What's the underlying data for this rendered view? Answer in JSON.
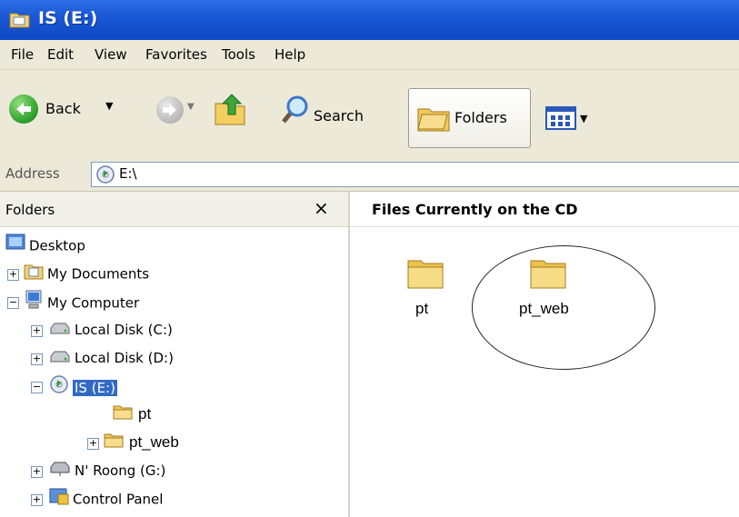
{
  "window": {
    "title": "IS (E:)"
  },
  "menu": [
    "File",
    "Edit",
    "View",
    "Favorites",
    "Tools",
    "Help"
  ],
  "toolbar": {
    "back_label": "Back",
    "search_label": "Search",
    "folders_label": "Folders"
  },
  "address": {
    "label": "Address",
    "value": "E:\\"
  },
  "folders_pane": {
    "title": "Folders",
    "close_glyph": "×",
    "tree": [
      {
        "label": "Desktop",
        "icon": "desktop-icon",
        "expander": ""
      },
      {
        "label": "My Documents",
        "icon": "my-documents-icon",
        "expander": "+"
      },
      {
        "label": "My Computer",
        "icon": "my-computer-icon",
        "expander": "−"
      },
      {
        "label": "Local Disk (C:)",
        "icon": "hard-drive-icon",
        "expander": "+"
      },
      {
        "label": "Local Disk (D:)",
        "icon": "hard-drive-icon",
        "expander": "+"
      },
      {
        "label": "IS (E:)",
        "icon": "cd-drive-icon",
        "expander": "−",
        "selected": true
      },
      {
        "label": "pt",
        "icon": "folder-icon",
        "expander": ""
      },
      {
        "label": "pt_web",
        "icon": "folder-icon",
        "expander": "+"
      },
      {
        "label": "N' Roong (G:)",
        "icon": "network-drive-icon",
        "expander": "+"
      },
      {
        "label": "Control Panel",
        "icon": "control-panel-icon",
        "expander": "+"
      }
    ]
  },
  "content": {
    "header": "Files Currently on the CD",
    "items": [
      {
        "label": "pt",
        "icon": "folder-icon"
      },
      {
        "label": "pt_web",
        "icon": "folder-icon",
        "circled": true
      }
    ]
  },
  "colors": {
    "titlebar": "#1a58d6",
    "selection": "#316ac5",
    "chrome": "#ece9d8"
  }
}
